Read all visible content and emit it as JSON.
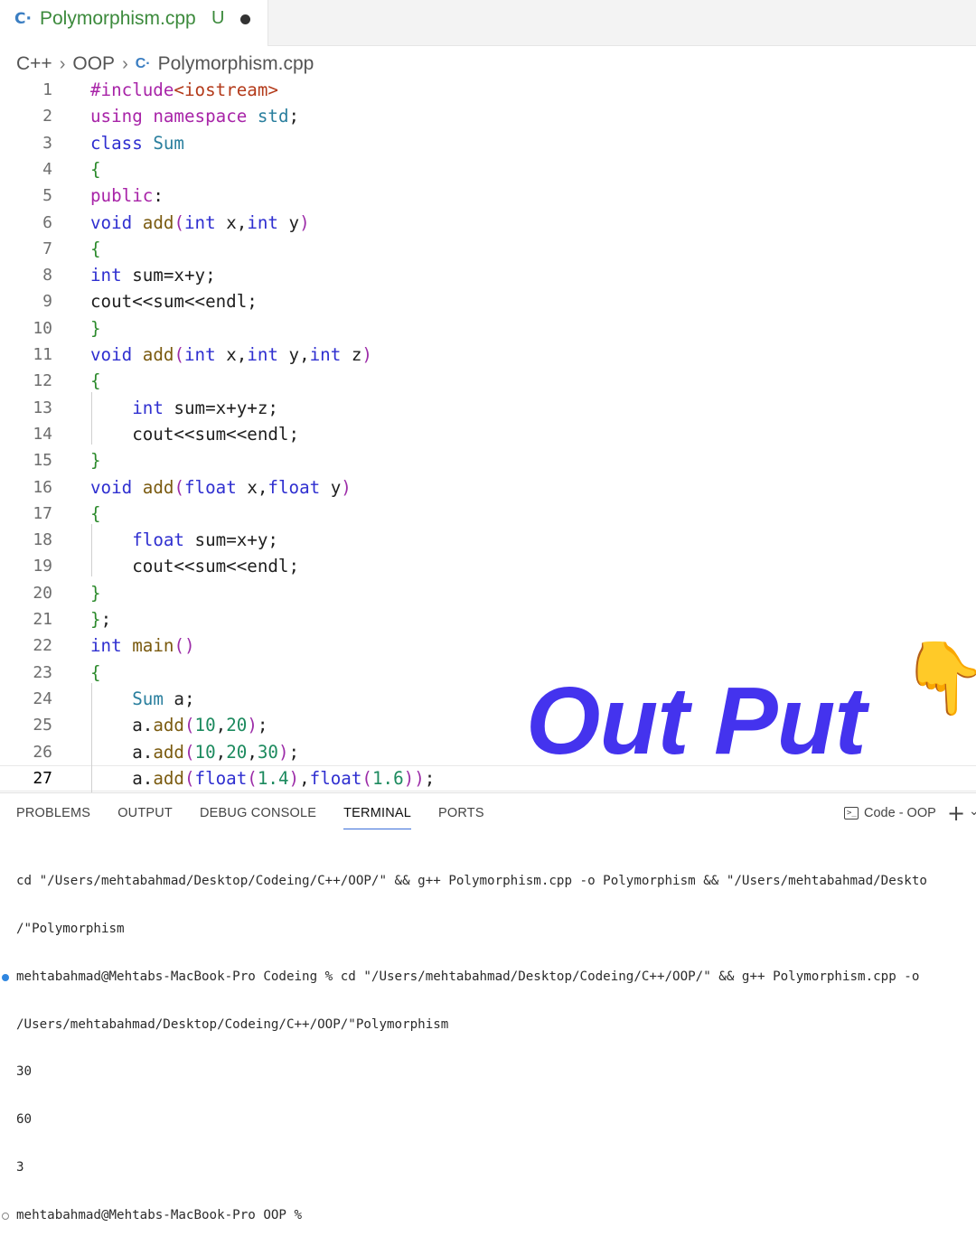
{
  "tab": {
    "filename": "Polymorphism.cpp",
    "status": "U",
    "icon": "cpp-file-icon"
  },
  "breadcrumb": {
    "items": [
      "C++",
      "OOP",
      "Polymorphism.cpp"
    ]
  },
  "editor": {
    "current_line": 27,
    "lines": [
      {
        "n": "1"
      },
      {
        "n": "2"
      },
      {
        "n": "3"
      },
      {
        "n": "4"
      },
      {
        "n": "5"
      },
      {
        "n": "6"
      },
      {
        "n": "7"
      },
      {
        "n": "8"
      },
      {
        "n": "9"
      },
      {
        "n": "10"
      },
      {
        "n": "11"
      },
      {
        "n": "12"
      },
      {
        "n": "13"
      },
      {
        "n": "14"
      },
      {
        "n": "15"
      },
      {
        "n": "16"
      },
      {
        "n": "17"
      },
      {
        "n": "18"
      },
      {
        "n": "19"
      },
      {
        "n": "20"
      },
      {
        "n": "21"
      },
      {
        "n": "22"
      },
      {
        "n": "23"
      },
      {
        "n": "24"
      },
      {
        "n": "25"
      },
      {
        "n": "26"
      },
      {
        "n": "27"
      }
    ],
    "code": [
      "#include<iostream>",
      "using namespace std;",
      "class Sum",
      "{",
      "public:",
      "void add(int x,int y)",
      "{",
      "int sum=x+y;",
      "cout<<sum<<endl;",
      "}",
      "void add(int x,int y,int z)",
      "{",
      "    int sum=x+y+z;",
      "    cout<<sum<<endl;",
      "}",
      "void add(float x,float y)",
      "{",
      "    float sum=x+y;",
      "    cout<<sum<<endl;",
      "}",
      "};",
      "int main()",
      "{",
      "    Sum a;",
      "    a.add(10,20);",
      "    a.add(10,20,30);",
      "    a.add(float(1.4),float(1.6));"
    ]
  },
  "overlay": {
    "title": "Out Put",
    "emoji": "👇"
  },
  "panel": {
    "tabs": [
      "PROBLEMS",
      "OUTPUT",
      "DEBUG CONSOLE",
      "TERMINAL",
      "PORTS"
    ],
    "active_tab": "TERMINAL",
    "terminal_name": "Code - OOP",
    "terminal_lines": [
      "cd \"/Users/mehtabahmad/Desktop/Codeing/C++/OOP/\" && g++ Polymorphism.cpp -o Polymorphism && \"/Users/mehtabahmad/Deskto",
      "/\"Polymorphism",
      "mehtabahmad@Mehtabs-MacBook-Pro Codeing % cd \"/Users/mehtabahmad/Desktop/Codeing/C++/OOP/\" && g++ Polymorphism.cpp -o",
      "/Users/mehtabahmad/Desktop/Codeing/C++/OOP/\"Polymorphism",
      "30",
      "60",
      "3",
      "mehtabahmad@Mehtabs-MacBook-Pro OOP %"
    ]
  }
}
